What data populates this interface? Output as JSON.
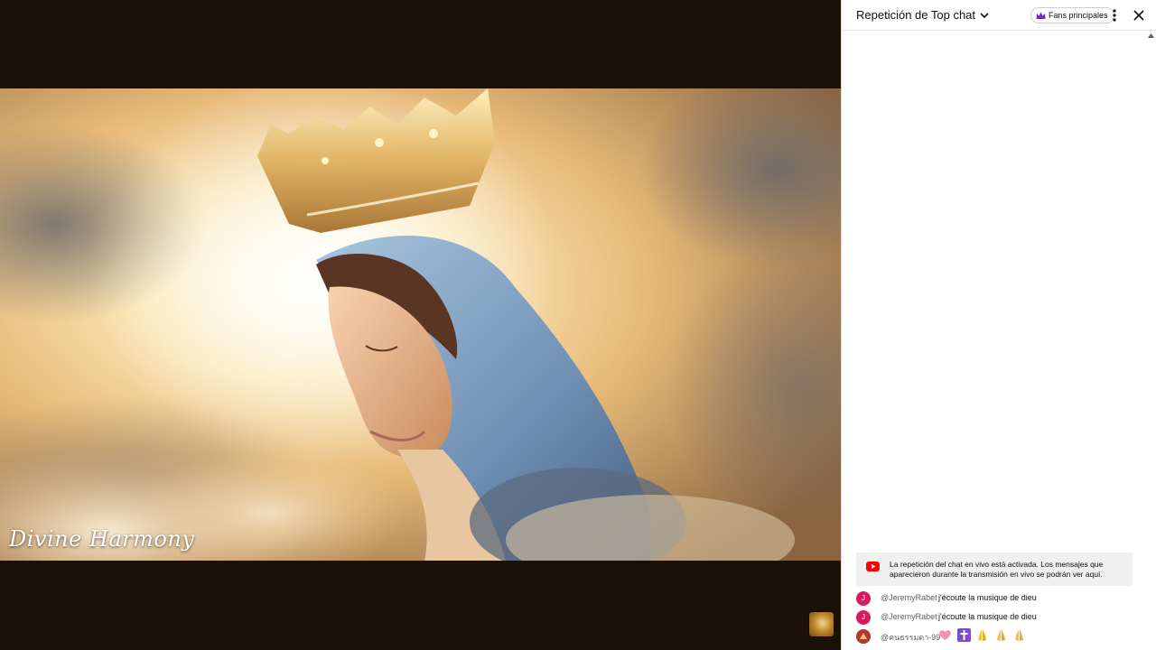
{
  "video": {
    "watermark": "Divine Harmony",
    "endcard_icon": "channel-thumbnail-icon"
  },
  "chat": {
    "title": "Repetición de Top chat",
    "fans_label": "Fans principales",
    "notice": "La repetición del chat en vivo está activada. Los mensajes que aparecieron durante la transmisión en vivo se podrán ver aquí.",
    "messages": [
      {
        "avatar": "J",
        "author": "@JeremyRabet",
        "text": "j'écoute la musique de dieu",
        "avatar_color": "#d81b60"
      },
      {
        "avatar": "J",
        "author": "@JeremyRabet",
        "text": "j'écoute la musique de dieu",
        "avatar_color": "#d81b60"
      },
      {
        "avatar": "",
        "author": "@คนธรรมดา-99",
        "text": "",
        "emojis": [
          "pink-heart-icon",
          "latin-cross-icon",
          "folded-hands-icon",
          "folded-hands-icon",
          "folded-hands-icon"
        ],
        "avatar_color": "#c0392b"
      }
    ]
  },
  "colors": {
    "accent_red": "#ff0000",
    "crown_purple": "#6f2dbd",
    "background": "#1a1208"
  }
}
